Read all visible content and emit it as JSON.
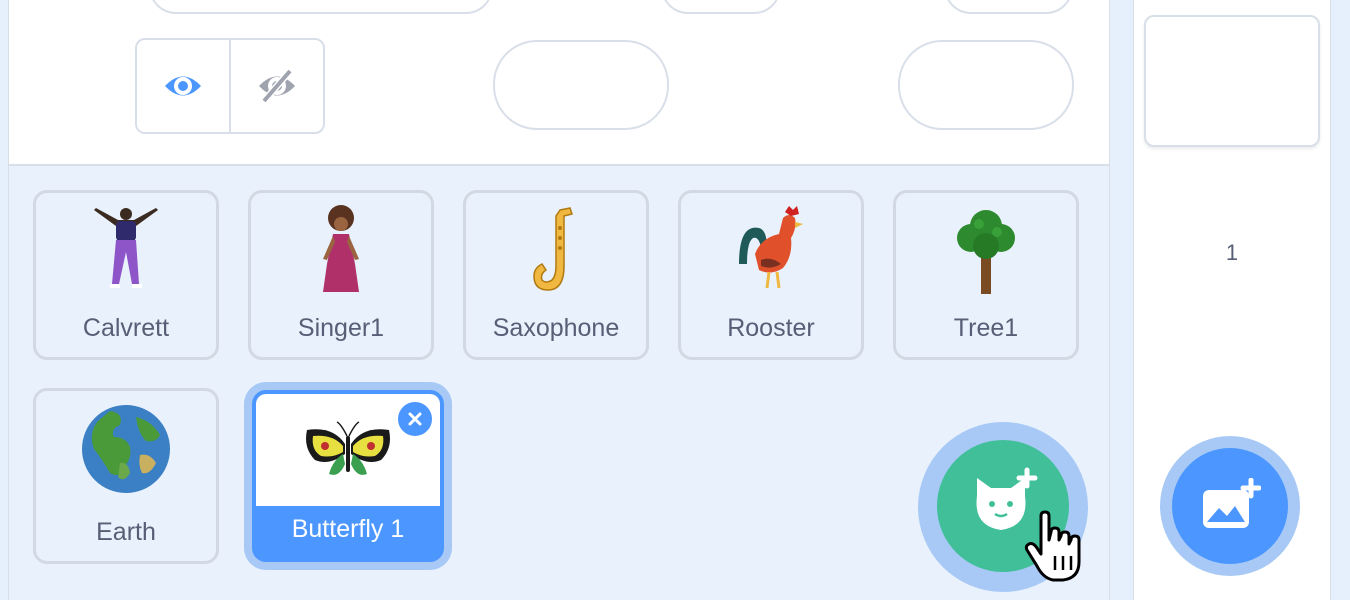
{
  "colors": {
    "accent": "#4c97ff",
    "sprite_button": "#40bf99",
    "pane_bg": "#e9f1fc",
    "border": "#d9dfe9",
    "label_text": "#575e75"
  },
  "visibility": {
    "show_icon": "eye-icon",
    "hide_icon": "eye-slash-icon"
  },
  "sprites": [
    {
      "label": "Calvrett",
      "icon": "dancer-figure"
    },
    {
      "label": "Singer1",
      "icon": "singer-figure"
    },
    {
      "label": "Saxophone",
      "icon": "saxophone"
    },
    {
      "label": "Rooster",
      "icon": "rooster"
    },
    {
      "label": "Tree1",
      "icon": "tree"
    },
    {
      "label": "Earth",
      "icon": "globe"
    },
    {
      "label": "Butterfly 1",
      "icon": "butterfly",
      "selected": true
    }
  ],
  "buttons": {
    "choose_sprite_icon": "cat-plus-icon",
    "choose_backdrop_icon": "image-plus-icon",
    "delete_icon": "close-icon"
  },
  "stage": {
    "backdrop_count": "1"
  }
}
